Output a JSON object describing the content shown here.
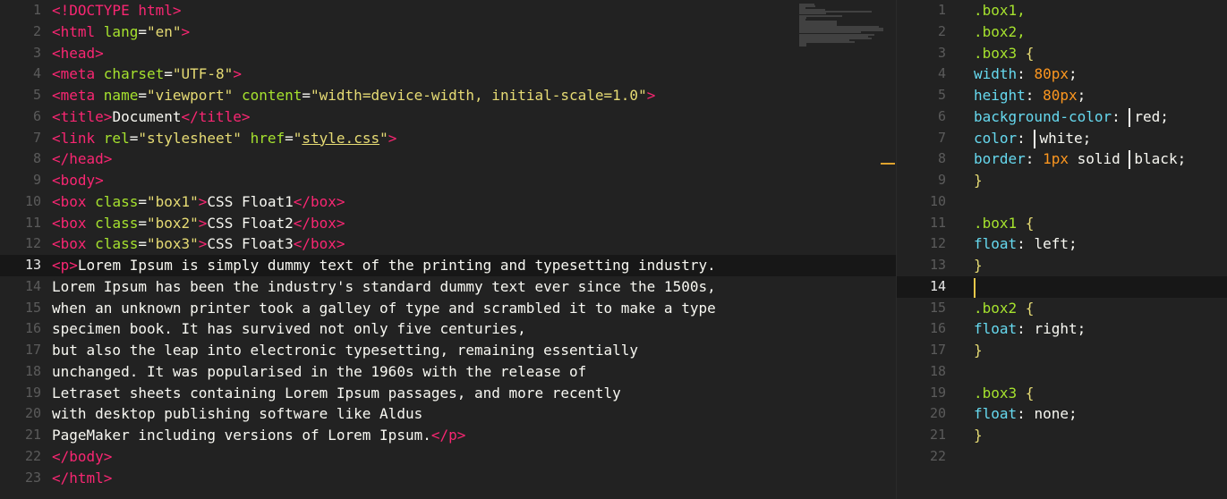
{
  "left_editor": {
    "lines": [
      {
        "n": "1",
        "indent": 0,
        "tokens": [
          [
            "tag",
            "<!DOCTYPE html>"
          ]
        ]
      },
      {
        "n": "2",
        "indent": 0,
        "tokens": [
          [
            "tag",
            "<html "
          ],
          [
            "attr",
            "lang"
          ],
          [
            "txt",
            "="
          ],
          [
            "str",
            "\"en\""
          ],
          [
            "tag",
            ">"
          ]
        ]
      },
      {
        "n": "3",
        "indent": 0,
        "tokens": [
          [
            "tag",
            "<head>"
          ]
        ]
      },
      {
        "n": "4",
        "indent": 1,
        "tokens": [
          [
            "tag",
            "<meta "
          ],
          [
            "attr",
            "charset"
          ],
          [
            "txt",
            "="
          ],
          [
            "str",
            "\"UTF-8\""
          ],
          [
            "tag",
            ">"
          ]
        ]
      },
      {
        "n": "5",
        "indent": 1,
        "tokens": [
          [
            "tag",
            "<meta "
          ],
          [
            "attr",
            "name"
          ],
          [
            "txt",
            "="
          ],
          [
            "str",
            "\"viewport\" "
          ],
          [
            "attr",
            "content"
          ],
          [
            "txt",
            "="
          ],
          [
            "str",
            "\"width=device-width, initial-scale=1.0\""
          ],
          [
            "tag",
            ">"
          ]
        ]
      },
      {
        "n": "6",
        "indent": 1,
        "tokens": [
          [
            "tag",
            "<title>"
          ],
          [
            "txt",
            "Document"
          ],
          [
            "tag",
            "</title>"
          ]
        ]
      },
      {
        "n": "7",
        "indent": 1,
        "tokens": [
          [
            "tag",
            "<link "
          ],
          [
            "attr",
            "rel"
          ],
          [
            "txt",
            "="
          ],
          [
            "str",
            "\"stylesheet\" "
          ],
          [
            "attr",
            "href"
          ],
          [
            "txt",
            "="
          ],
          [
            "str",
            "\""
          ],
          [
            "link",
            "style.css"
          ],
          [
            "str",
            "\""
          ],
          [
            "tag",
            ">"
          ]
        ]
      },
      {
        "n": "8",
        "indent": 0,
        "tokens": [
          [
            "tag",
            "</head>"
          ]
        ]
      },
      {
        "n": "9",
        "indent": 0,
        "tokens": [
          [
            "tag",
            "<body>"
          ]
        ]
      },
      {
        "n": "10",
        "indent": 1,
        "tokens": [
          [
            "tag",
            "<box "
          ],
          [
            "attr",
            "class"
          ],
          [
            "txt",
            "="
          ],
          [
            "str",
            "\"box1\""
          ],
          [
            "tag",
            ">"
          ],
          [
            "txt",
            "CSS Float1"
          ],
          [
            "tag",
            "</box>"
          ]
        ]
      },
      {
        "n": "11",
        "indent": 1,
        "tokens": [
          [
            "tag",
            "<box "
          ],
          [
            "attr",
            "class"
          ],
          [
            "txt",
            "="
          ],
          [
            "str",
            "\"box2\""
          ],
          [
            "tag",
            ">"
          ],
          [
            "txt",
            "CSS Float2"
          ],
          [
            "tag",
            "</box>"
          ]
        ]
      },
      {
        "n": "12",
        "indent": 1,
        "tokens": [
          [
            "tag",
            "<box "
          ],
          [
            "attr",
            "class"
          ],
          [
            "txt",
            "="
          ],
          [
            "str",
            "\"box3\""
          ],
          [
            "tag",
            ">"
          ],
          [
            "txt",
            "CSS Float3"
          ],
          [
            "tag",
            "</box>"
          ]
        ]
      },
      {
        "n": "13",
        "indent": 1,
        "current": true,
        "tokens": [
          [
            "tag",
            "<p>"
          ],
          [
            "txt",
            "Lorem Ipsum is simply dummy text of the printing and typesetting industry."
          ]
        ]
      },
      {
        "n": "14",
        "indent": 2,
        "tokens": [
          [
            "txt",
            "Lorem Ipsum has been the industry's standard dummy text ever since the 1500s,"
          ]
        ]
      },
      {
        "n": "15",
        "indent": 2,
        "tokens": [
          [
            "txt",
            "when an unknown printer took a galley of type and scrambled it to make a type"
          ]
        ]
      },
      {
        "n": "16",
        "indent": 2,
        "tokens": [
          [
            "txt",
            "specimen book. It has survived not only five centuries,"
          ]
        ]
      },
      {
        "n": "17",
        "indent": 2,
        "tokens": [
          [
            "txt",
            "but also the leap into electronic typesetting, remaining essentially"
          ]
        ]
      },
      {
        "n": "18",
        "indent": 2,
        "tokens": [
          [
            "txt",
            "unchanged. It was popularised in the 1960s with the release of"
          ]
        ]
      },
      {
        "n": "19",
        "indent": 2,
        "tokens": [
          [
            "txt",
            "Letraset sheets containing Lorem Ipsum passages, and more recently"
          ]
        ]
      },
      {
        "n": "20",
        "indent": 2,
        "tokens": [
          [
            "txt",
            "with desktop publishing software like Aldus"
          ]
        ]
      },
      {
        "n": "21",
        "indent": 2,
        "tokens": [
          [
            "txt",
            "PageMaker including versions of Lorem Ipsum."
          ],
          [
            "tag",
            "</p>"
          ]
        ]
      },
      {
        "n": "22",
        "indent": 0,
        "tokens": [
          [
            "tag",
            "</body>"
          ]
        ]
      },
      {
        "n": "23",
        "indent": 0,
        "tokens": [
          [
            "tag",
            "</html>"
          ]
        ]
      }
    ]
  },
  "right_editor": {
    "lines": [
      {
        "n": "1",
        "indent": 0,
        "tokens": [
          [
            "sel",
            ".box1,"
          ]
        ]
      },
      {
        "n": "2",
        "indent": 0,
        "tokens": [
          [
            "sel",
            ".box2,"
          ]
        ]
      },
      {
        "n": "3",
        "indent": 0,
        "tokens": [
          [
            "sel",
            ".box3 "
          ],
          [
            "brace",
            "{"
          ]
        ]
      },
      {
        "n": "4",
        "indent": 1,
        "tokens": [
          [
            "prop",
            "width"
          ],
          [
            "val",
            ": "
          ],
          [
            "num",
            "80px"
          ],
          [
            "val",
            ";"
          ]
        ]
      },
      {
        "n": "5",
        "indent": 1,
        "tokens": [
          [
            "prop",
            "height"
          ],
          [
            "val",
            ": "
          ],
          [
            "num",
            "80px"
          ],
          [
            "val",
            ";"
          ]
        ]
      },
      {
        "n": "6",
        "indent": 1,
        "tokens": [
          [
            "prop",
            "background-color"
          ],
          [
            "val",
            ": "
          ],
          [
            "swatch",
            "#ff0000"
          ],
          [
            "val",
            "red;"
          ]
        ]
      },
      {
        "n": "7",
        "indent": 1,
        "tokens": [
          [
            "prop",
            "color"
          ],
          [
            "val",
            ": "
          ],
          [
            "swatch",
            "#ffffff"
          ],
          [
            "val",
            "white;"
          ]
        ]
      },
      {
        "n": "8",
        "indent": 1,
        "tokens": [
          [
            "prop",
            "border"
          ],
          [
            "val",
            ": "
          ],
          [
            "num",
            "1px"
          ],
          [
            "val",
            " solid "
          ],
          [
            "swatch",
            "#000000"
          ],
          [
            "val",
            "black;"
          ]
        ]
      },
      {
        "n": "9",
        "indent": 0,
        "tokens": [
          [
            "brace",
            "}"
          ]
        ]
      },
      {
        "n": "10",
        "indent": 0,
        "tokens": []
      },
      {
        "n": "11",
        "indent": 0,
        "tokens": [
          [
            "sel",
            ".box1 "
          ],
          [
            "brace",
            "{"
          ]
        ]
      },
      {
        "n": "12",
        "indent": 1,
        "tokens": [
          [
            "prop",
            "float"
          ],
          [
            "val",
            ": left;"
          ]
        ]
      },
      {
        "n": "13",
        "indent": 0,
        "tokens": [
          [
            "brace",
            "}"
          ]
        ]
      },
      {
        "n": "14",
        "indent": 0,
        "current": true,
        "tokens": []
      },
      {
        "n": "15",
        "indent": 0,
        "tokens": [
          [
            "sel",
            ".box2 "
          ],
          [
            "brace",
            "{"
          ]
        ]
      },
      {
        "n": "16",
        "indent": 1,
        "tokens": [
          [
            "prop",
            "float"
          ],
          [
            "val",
            ": right;"
          ]
        ]
      },
      {
        "n": "17",
        "indent": 0,
        "tokens": [
          [
            "brace",
            "}"
          ]
        ]
      },
      {
        "n": "18",
        "indent": 0,
        "tokens": []
      },
      {
        "n": "19",
        "indent": 0,
        "tokens": [
          [
            "sel",
            ".box3 "
          ],
          [
            "brace",
            "{"
          ]
        ]
      },
      {
        "n": "20",
        "indent": 1,
        "tokens": [
          [
            "prop",
            "float"
          ],
          [
            "val",
            ": none;"
          ]
        ]
      },
      {
        "n": "21",
        "indent": 0,
        "tokens": [
          [
            "brace",
            "}"
          ]
        ]
      },
      {
        "n": "22",
        "indent": 0,
        "tokens": []
      }
    ]
  },
  "colors": {
    "background": "#222222",
    "tag": "#f92672",
    "attribute": "#a6e22e",
    "string": "#e6db74",
    "property": "#66d9ef",
    "number": "#fd971f",
    "cursor": "#e6c84a"
  }
}
